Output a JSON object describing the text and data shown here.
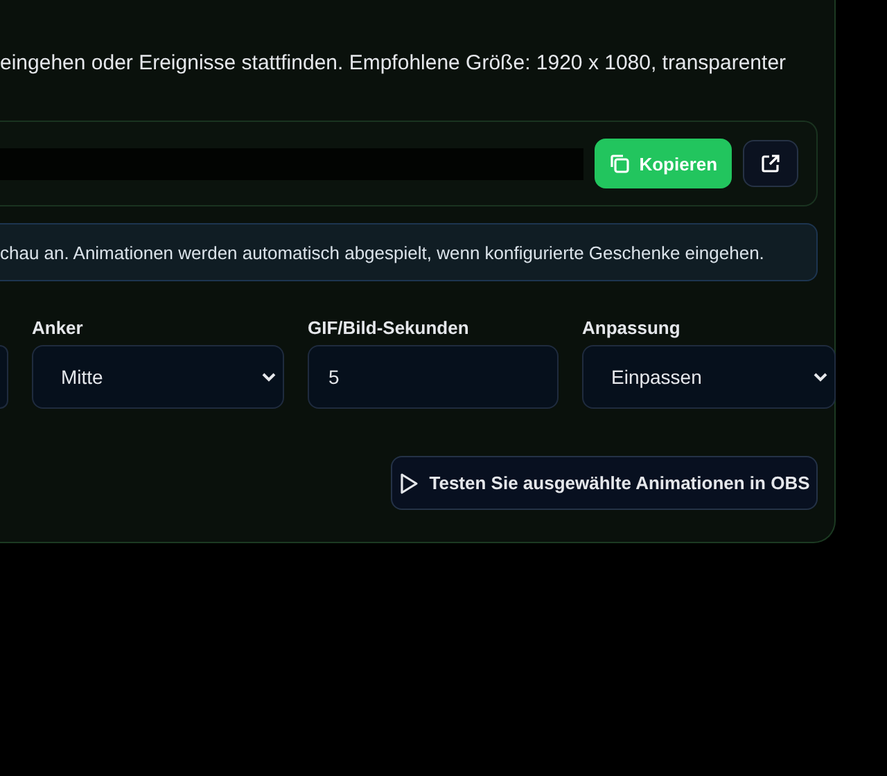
{
  "description": "eingehen oder Ereignisse stattfinden. Empfohlene Größe: 1920 x 1080, transparenter",
  "url_bar": {
    "copy_button": "Kopieren"
  },
  "info": "chau an. Animationen werden automatisch abgespielt, wenn konfigurierte Geschenke eingehen.",
  "fields": [
    {
      "kind": "select",
      "label": "Anker",
      "value": "Mitte"
    },
    {
      "kind": "input",
      "label": "GIF/Bild-Sekunden",
      "value": "5"
    },
    {
      "kind": "select",
      "label": "Anpassung",
      "value": "Einpassen"
    }
  ],
  "test_button": "Testen Sie ausgewählte Animationen in OBS"
}
